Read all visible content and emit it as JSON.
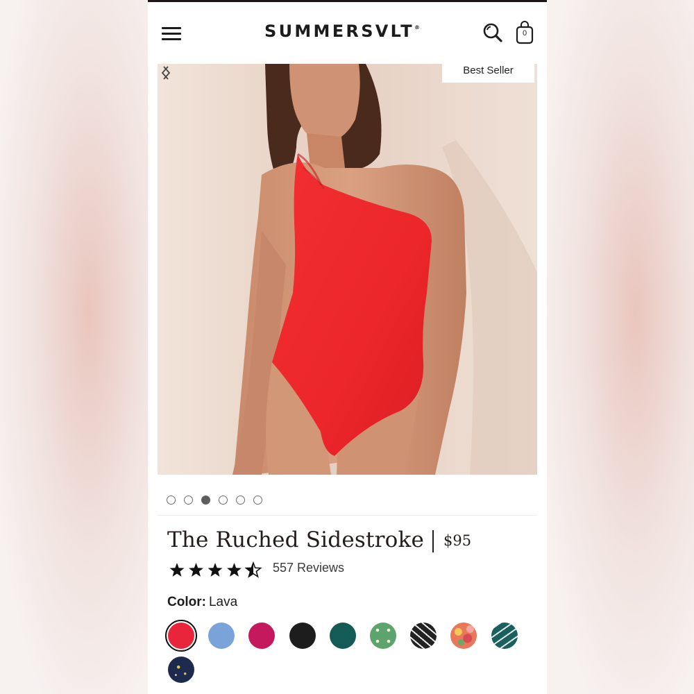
{
  "header": {
    "brand": "SUMMERSVLT",
    "brand_mark": "®",
    "cart_count": "0",
    "icons": [
      "hamburger-icon",
      "search-icon",
      "shopping-bag-icon"
    ]
  },
  "hero": {
    "badge": "Best Seller",
    "image_alt": "Model wearing a red one-shoulder swimsuit",
    "carousel": {
      "total_slides": 6,
      "active_index": 2
    }
  },
  "product": {
    "title": "The Ruched Sidestroke",
    "price": "$95",
    "rating": 4.5,
    "reviews_label": "557 Reviews",
    "color_label": "Color:",
    "color_value": "Lava"
  },
  "swatches": [
    {
      "name": "Lava",
      "color": "#e8253b",
      "selected": true
    },
    {
      "name": "swatch-2",
      "color": "#7aa3d9"
    },
    {
      "name": "swatch-3",
      "color": "#c4195c"
    },
    {
      "name": "swatch-4",
      "color": "#1d1d1d"
    },
    {
      "name": "swatch-5",
      "color": "#145a56"
    },
    {
      "name": "swatch-6",
      "color": "#5da36d",
      "pattern": "dot"
    },
    {
      "name": "swatch-7",
      "color": "#222222",
      "pattern": "leaf"
    },
    {
      "name": "swatch-8",
      "color": "#e9775a",
      "pattern": "floral"
    },
    {
      "name": "swatch-9",
      "color": "#1c5f5f",
      "pattern": "leaf-light"
    },
    {
      "name": "swatch-10",
      "color": "#1d2a4e",
      "pattern": "star"
    }
  ],
  "colors": {
    "accent": "#231c1a",
    "hero_suit": "#ee2a2a",
    "background": "#ffffff"
  }
}
